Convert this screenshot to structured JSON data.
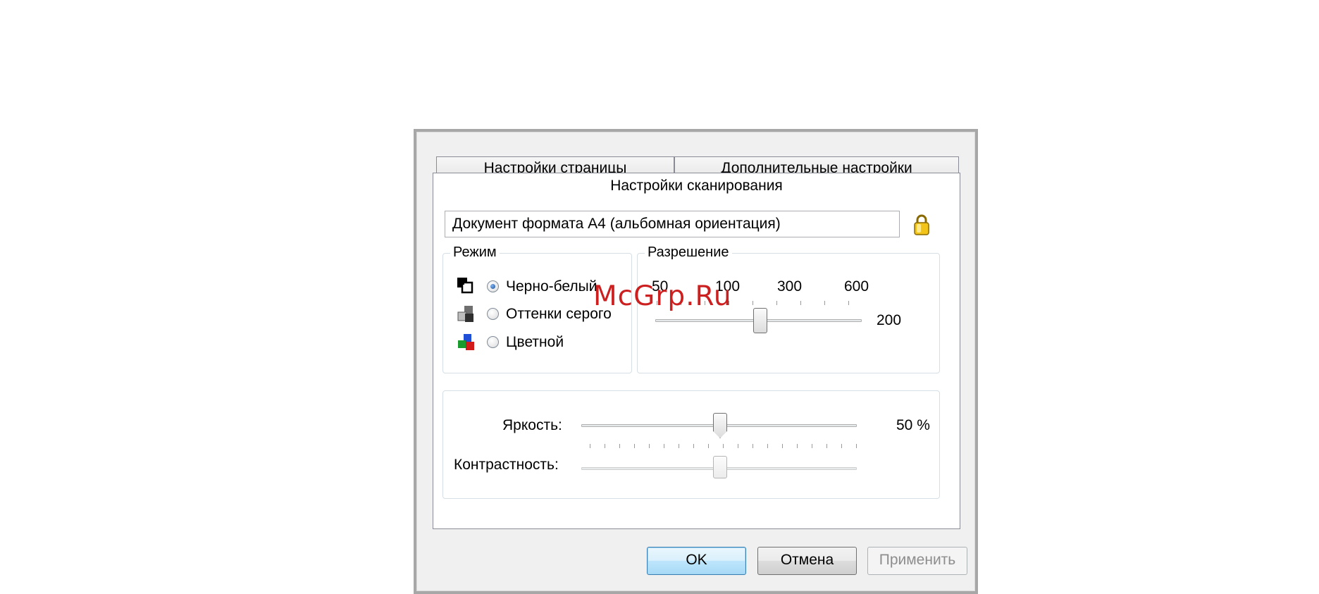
{
  "tabs": {
    "page_settings": "Настройки страницы",
    "advanced_settings": "Дополнительные настройки",
    "scan_settings": "Настройки сканирования"
  },
  "profile": {
    "value": "Документ формата A4 (альбомная ориентация)",
    "lock_icon": "lock-icon"
  },
  "mode": {
    "title": "Режим",
    "options": [
      {
        "label": "Черно-белый",
        "icon": "black-white-icon",
        "selected": true
      },
      {
        "label": "Оттенки серого",
        "icon": "grayscale-icon",
        "selected": false
      },
      {
        "label": "Цветной",
        "icon": "color-icon",
        "selected": false
      }
    ]
  },
  "resolution": {
    "title": "Разрешение",
    "scale_labels": [
      "50",
      "100",
      "300",
      "600"
    ],
    "value": "200"
  },
  "brightness": {
    "label": "Яркость:",
    "value": "50 %",
    "fraction": 0.5
  },
  "contrast": {
    "label": "Контрастность:",
    "fraction": 0.5,
    "enabled": false
  },
  "buttons": {
    "ok": "OK",
    "cancel": "Отмена",
    "apply": "Применить"
  },
  "watermark": "McGrp.Ru"
}
